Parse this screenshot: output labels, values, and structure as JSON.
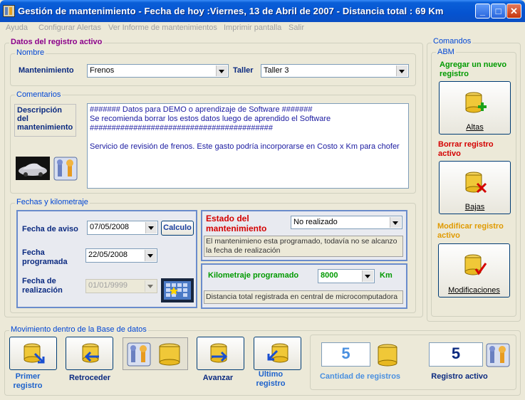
{
  "window": {
    "title": "Gestión de mantenimiento - Fecha de hoy :Viernes, 13 de Abril de 2007 - Distancia total :   69 Km",
    "min": "_",
    "max": "□",
    "close": "✕"
  },
  "menu": [
    "Ayuda",
    "Configurar Alertas",
    "Ver Informe de mantenimientos",
    "Imprimir pantalla",
    "Salir"
  ],
  "datos": {
    "legend": "Datos del registro activo",
    "nombre": {
      "legend": "Nombre",
      "mantenimiento_label": "Mantenimiento",
      "mantenimiento_value": "Frenos",
      "taller_label": "Taller",
      "taller_value": "Taller 3"
    },
    "comentarios": {
      "legend": "Comentarios",
      "descripcion_label": "Descripción del mantenimiento",
      "text": "####### Datos para DEMO o aprendizaje de Software #######\nSe recomienda borrar los estos datos luego de aprendido el Software\n##########################################\n\nServicio de revisión de frenos. Este gasto podría incorporarse en Costo x Km para chofer"
    },
    "fechas": {
      "legend": "Fechas y kilometraje",
      "aviso_label": "Fecha de aviso",
      "aviso_value": "07/05/2008",
      "calculo_button": "Calculo",
      "programada_label": "Fecha programada",
      "programada_value": "22/05/2008",
      "realizacion_label": "Fecha de realización",
      "realizacion_value": "01/01/9999",
      "estado_label": "Estado del mantenimiento",
      "estado_value": "No realizado",
      "estado_info": "El mantenimieno esta programado, todavía no se alcanzo la fecha de realización",
      "km_label": "Kilometraje programado",
      "km_value": "8000",
      "km_unit": "Km",
      "km_info": "Distancia total registrada en central de microcomputadora"
    }
  },
  "comandos": {
    "legend": "Comandos",
    "abm_legend": "ABM",
    "agregar_label": "Agregar un nuevo registro",
    "altas_button": "Altas",
    "borrar_label": "Borrar registro activo",
    "bajas_button": "Bajas",
    "modificar_label": "Modificar registro activo",
    "modificaciones_button": "Modificaciones"
  },
  "movimiento": {
    "legend": "Movimiento dentro de la Base de datos",
    "primer": "Primer registro",
    "retroceder": "Retroceder",
    "avanzar": "Avanzar",
    "ultimo": "Ultimo registro",
    "cantidad_value": "5",
    "cantidad_label": "Cantidad de registros",
    "activo_value": "5",
    "activo_label": "Registro activo"
  },
  "colors": {
    "title_blue": "#0553d0",
    "frame_blue": "#6a8ccc",
    "red": "#d40000",
    "green": "#009a00",
    "orange": "#e09a00"
  }
}
